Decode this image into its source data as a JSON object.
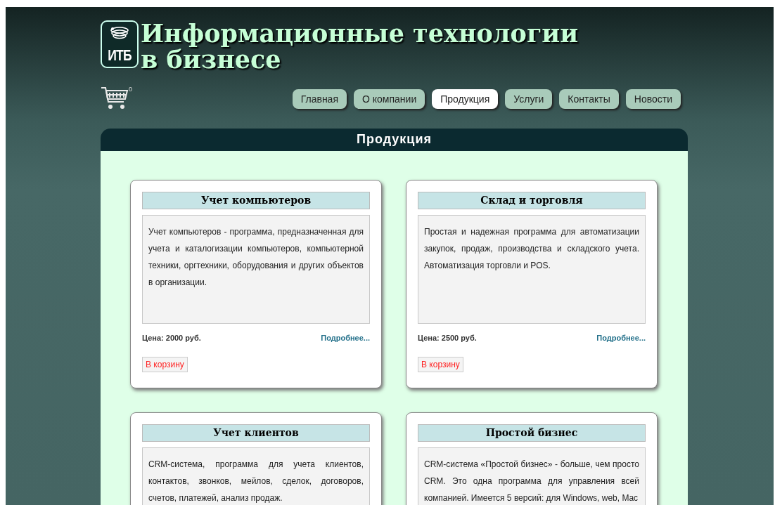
{
  "site": {
    "logo_text": "ИТБ",
    "title_lines": [
      "Информационные технологии",
      "в бизнесе"
    ]
  },
  "cart": {
    "count": "0"
  },
  "nav": [
    {
      "label": "Главная",
      "selected": false
    },
    {
      "label": "О компании",
      "selected": false
    },
    {
      "label": "Продукция",
      "selected": true
    },
    {
      "label": "Услуги",
      "selected": false
    },
    {
      "label": "Контакты",
      "selected": false
    },
    {
      "label": "Новости",
      "selected": false
    }
  ],
  "panel": {
    "title": "Продукция"
  },
  "products": [
    {
      "title": "Учет компьютеров",
      "description": "Учет компьютеров - программа, предназначенная для учета и каталогизации компьютеров, компьютерной техники, оргтехники, оборудования и других объектов в организации.",
      "price": "Цена: 2000 руб.",
      "more": "Подробнее...",
      "button": "В корзину"
    },
    {
      "title": "Склад и торговля",
      "description": "Простая и надежная программа для автоматизации закупок, продаж, производства и складского учета. Автоматизация торговли и POS.",
      "price": "Цена: 2500 руб.",
      "more": "Подробнее...",
      "button": "В корзину"
    },
    {
      "title": "Учет клиентов",
      "description": "CRM-система, программа для учета клиентов, контактов, звонков, мейлов, сделок, договоров, счетов, платежей, анализ продаж."
    },
    {
      "title": "Простой бизнес",
      "description": "CRM-система «Простой бизнес» - больше, чем просто CRM. Это одна программа для управления всей компанией. Имеется 5 версий: для Windows, web, Mac"
    }
  ]
}
